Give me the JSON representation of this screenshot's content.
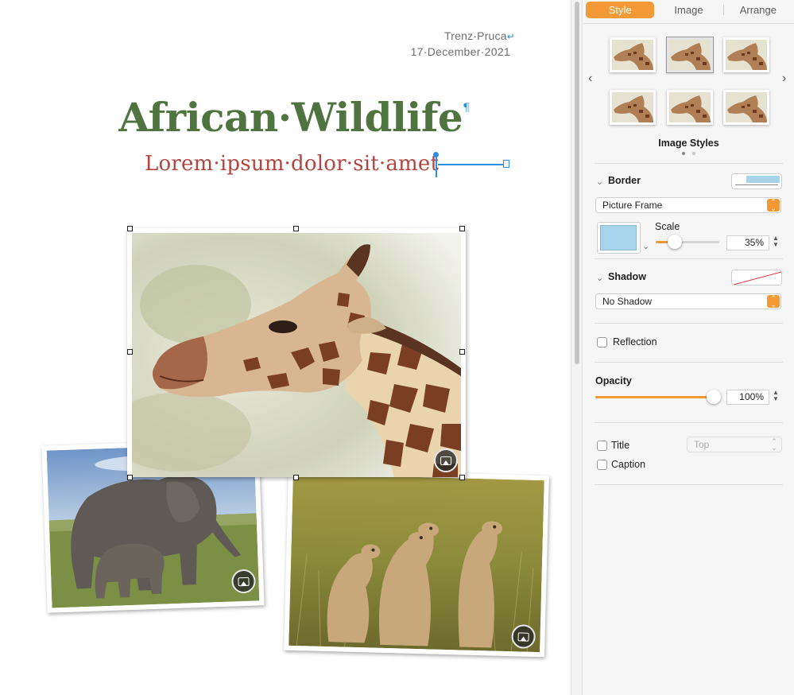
{
  "document": {
    "author": "Trenz·Pruca",
    "date": "17·December·2021",
    "title": "African·Wildlife",
    "subtitle": "Lorem·ipsum·dolor·sit·amet",
    "return_mark": "↵",
    "pilcrow": "¶"
  },
  "photos": [
    {
      "subject": "giraffe",
      "badge_icon": "image-icon"
    },
    {
      "subject": "elephants",
      "badge_icon": "image-icon"
    },
    {
      "subject": "meerkats",
      "badge_icon": "image-icon"
    }
  ],
  "inspector": {
    "tabs": [
      {
        "label": "Style",
        "active": true
      },
      {
        "label": "Image",
        "active": false
      },
      {
        "label": "Arrange",
        "active": false
      }
    ],
    "image_styles": {
      "label": "Image Styles",
      "count": 6,
      "selected_index": 1,
      "page_dots": 2,
      "current_page": 1
    },
    "border": {
      "label": "Border",
      "type": "Picture Frame",
      "color": "#a7d4ea",
      "scale_label": "Scale",
      "scale_value": "35%",
      "scale_fraction": 0.3
    },
    "shadow": {
      "label": "Shadow",
      "type": "No Shadow"
    },
    "reflection": {
      "label": "Reflection",
      "checked": false
    },
    "opacity": {
      "label": "Opacity",
      "value": "100%",
      "fraction": 1.0
    },
    "title_check": {
      "label": "Title",
      "checked": false,
      "position": "Top"
    },
    "caption_check": {
      "label": "Caption",
      "checked": false
    },
    "accent": "#f39a36"
  }
}
